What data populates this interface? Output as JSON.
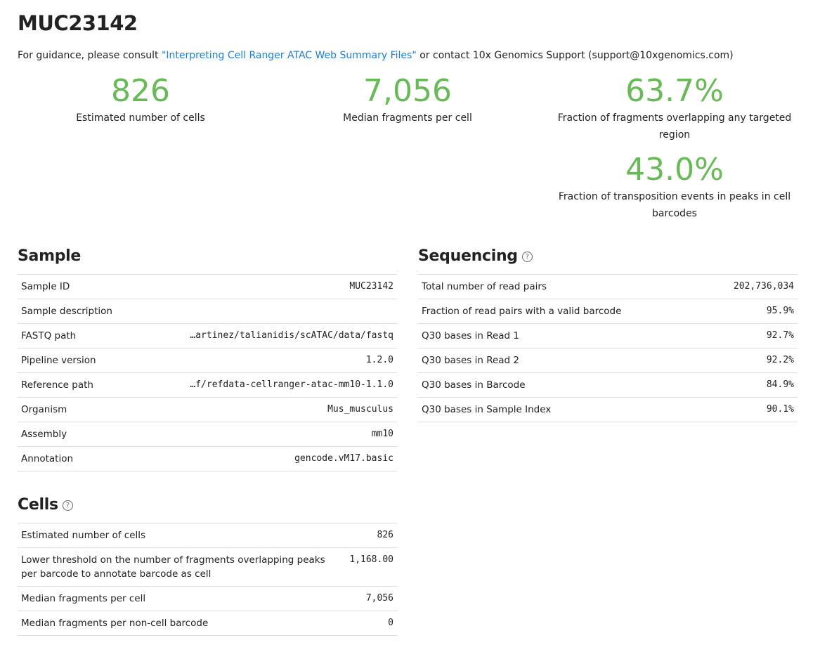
{
  "title": "MUC23142",
  "guidance": {
    "prefix": "For guidance, please consult ",
    "link": "\"Interpreting Cell Ranger ATAC Web Summary Files\"",
    "suffix": " or contact 10x Genomics Support (support@10xgenomics.com)"
  },
  "metrics": [
    {
      "value": "826",
      "label": "Estimated number of cells"
    },
    {
      "value": "7,056",
      "label": "Median fragments per cell"
    },
    {
      "value": "63.7%",
      "label": "Fraction of fragments overlapping any targeted region"
    },
    {
      "value": "43.0%",
      "label": "Fraction of transposition events in peaks in cell barcodes"
    }
  ],
  "accent_color": "#66bb55",
  "sample": {
    "title": "Sample",
    "rows": [
      {
        "label": "Sample ID",
        "value": "MUC23142"
      },
      {
        "label": "Sample description",
        "value": ""
      },
      {
        "label": "FASTQ path",
        "value": "…artinez/talianidis/scATAC/data/fastq"
      },
      {
        "label": "Pipeline version",
        "value": "1.2.0"
      },
      {
        "label": "Reference path",
        "value": "…f/refdata-cellranger-atac-mm10-1.1.0"
      },
      {
        "label": "Organism",
        "value": "Mus_musculus"
      },
      {
        "label": "Assembly",
        "value": "mm10"
      },
      {
        "label": "Annotation",
        "value": "gencode.vM17.basic"
      }
    ]
  },
  "cells": {
    "title": "Cells",
    "rows": [
      {
        "label": "Estimated number of cells",
        "value": "826"
      },
      {
        "label": "Lower threshold on the number of fragments overlapping peaks per barcode to annotate barcode as cell",
        "value": "1,168.00"
      },
      {
        "label": "Median fragments per cell",
        "value": "7,056"
      },
      {
        "label": "Median fragments per non-cell barcode",
        "value": "0"
      }
    ]
  },
  "sequencing": {
    "title": "Sequencing",
    "rows": [
      {
        "label": "Total number of read pairs",
        "value": "202,736,034"
      },
      {
        "label": "Fraction of read pairs with a valid barcode",
        "value": "95.9%"
      },
      {
        "label": "Q30 bases in Read 1",
        "value": "92.7%"
      },
      {
        "label": "Q30 bases in Read 2",
        "value": "92.2%"
      },
      {
        "label": "Q30 bases in Barcode",
        "value": "84.9%"
      },
      {
        "label": "Q30 bases in Sample Index",
        "value": "90.1%"
      }
    ]
  },
  "help_icon": "?"
}
